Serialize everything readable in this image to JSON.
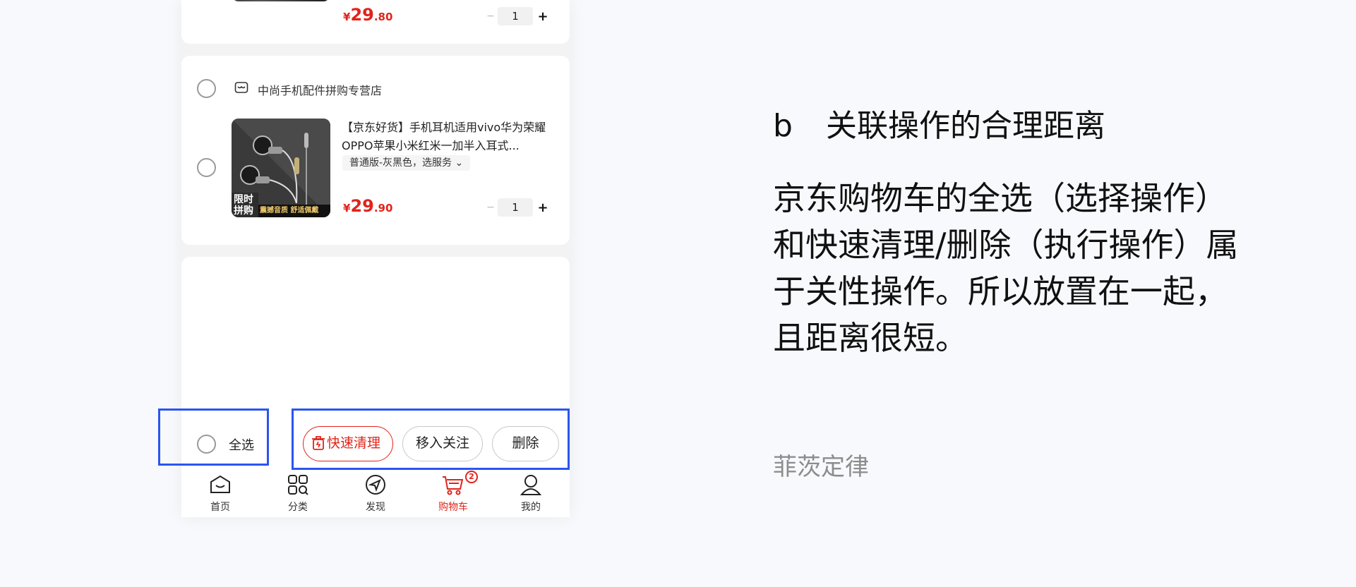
{
  "prev_item": {
    "price_yen": "¥",
    "price_int": "29",
    "price_dec": ".80",
    "minus": "−",
    "qty": "1",
    "plus": "+"
  },
  "shop": {
    "name": "中尚手机配件拼购专营店",
    "item": {
      "title": "【京东好货】手机耳机适用vivo华为荣耀OPPO苹果小米红米一加半入耳式...",
      "spec": "普通版-灰黑色，选服务 ⌄",
      "thumb_badge": "限时\n拼购",
      "thumb_caption": "震撼音质 舒适佩戴",
      "price_yen": "¥",
      "price_int": "29",
      "price_dec": ".90",
      "minus": "−",
      "qty": "1",
      "plus": "+"
    }
  },
  "bottom_bar": {
    "select_all": "全选",
    "quick_clean": "快速清理",
    "move_to_follow": "移入关注",
    "delete": "删除"
  },
  "tabbar": {
    "items": [
      {
        "label": "首页",
        "icon": "home-icon"
      },
      {
        "label": "分类",
        "icon": "category-icon"
      },
      {
        "label": "发现",
        "icon": "discover-icon"
      },
      {
        "label": "购物车",
        "icon": "cart-icon",
        "badge": "2",
        "active": true
      },
      {
        "label": "我的",
        "icon": "user-icon"
      }
    ]
  },
  "panel": {
    "heading_label": "b",
    "heading_text": "关联操作的合理距离",
    "body": "京东购物车的全选（选择操作）和快速清理/删除（执行操作）属于关性操作。所以放置在一起，且距离很短。",
    "footer": "菲茨定律"
  },
  "colors": {
    "accent_red": "#e2231a",
    "highlight_blue": "#2b55f0"
  }
}
